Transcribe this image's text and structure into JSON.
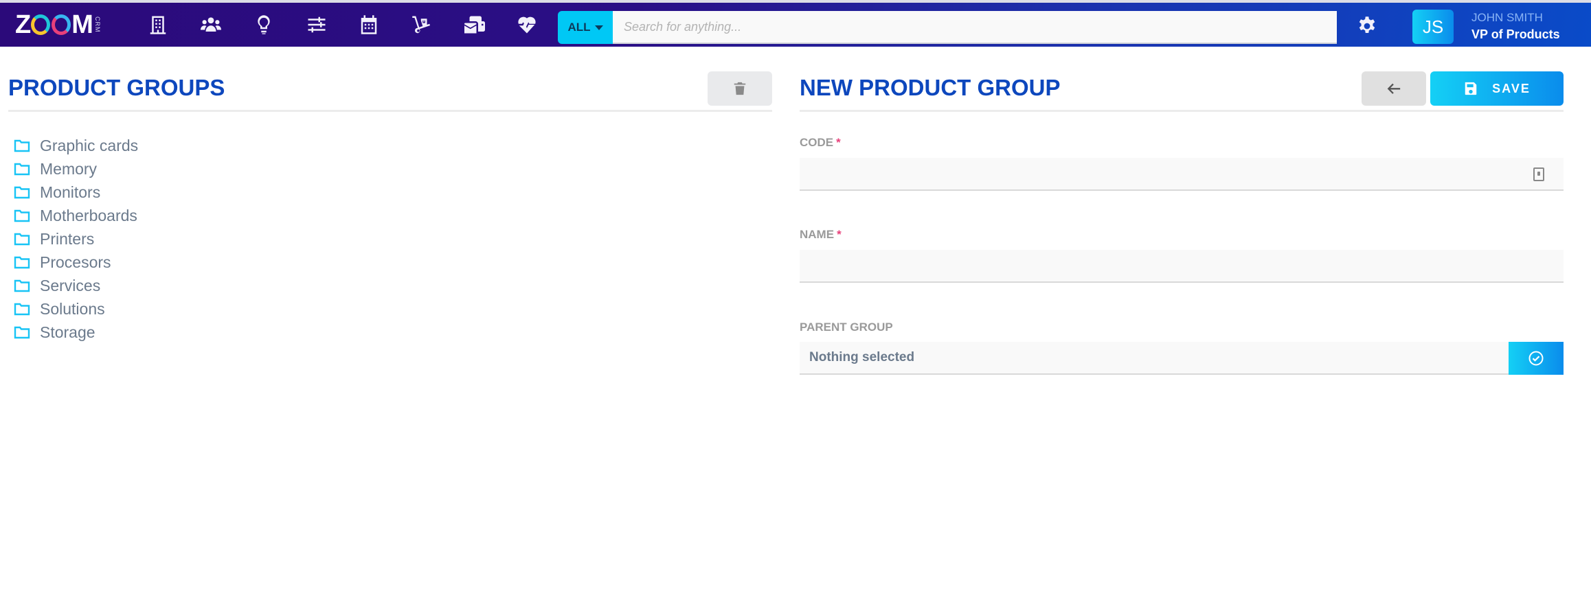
{
  "app": {
    "logo_text": "ZOOM",
    "logo_sub": "CRM"
  },
  "nav": {
    "icons": [
      {
        "name": "companies",
        "icon": "building-icon"
      },
      {
        "name": "contacts",
        "icon": "users-icon"
      },
      {
        "name": "ideas",
        "icon": "lightbulb-icon"
      },
      {
        "name": "settings-sliders",
        "icon": "sliders-icon"
      },
      {
        "name": "calendar",
        "icon": "calendar-icon"
      },
      {
        "name": "products",
        "icon": "dolly-icon"
      },
      {
        "name": "mail",
        "icon": "envelope-icon"
      },
      {
        "name": "health",
        "icon": "heartbeat-icon"
      }
    ],
    "search": {
      "scope_label": "ALL",
      "placeholder": "Search for anything...",
      "value": ""
    },
    "settings_icon": "gear-icon",
    "user": {
      "initials": "JS",
      "name": "JOHN SMITH",
      "role": "VP of Products"
    }
  },
  "left_panel": {
    "title": "PRODUCT GROUPS",
    "delete_icon": "trash-icon",
    "groups": [
      "Graphic cards",
      "Memory",
      "Monitors",
      "Motherboards",
      "Printers",
      "Procesors",
      "Services",
      "Solutions",
      "Storage"
    ]
  },
  "right_panel": {
    "title": "NEW PRODUCT GROUP",
    "back_icon": "arrow-left-icon",
    "save_label": "SAVE",
    "fields": {
      "code": {
        "label": "CODE",
        "required_mark": "*",
        "value": ""
      },
      "name": {
        "label": "NAME",
        "required_mark": "*",
        "value": ""
      },
      "parent_group": {
        "label": "PARENT GROUP",
        "selected": "Nothing selected"
      }
    }
  },
  "colors": {
    "brand_blue": "#0d47bd",
    "accent_cyan": "#14d0f5",
    "required": "#e8407a",
    "text_muted": "#6b7a8c"
  }
}
